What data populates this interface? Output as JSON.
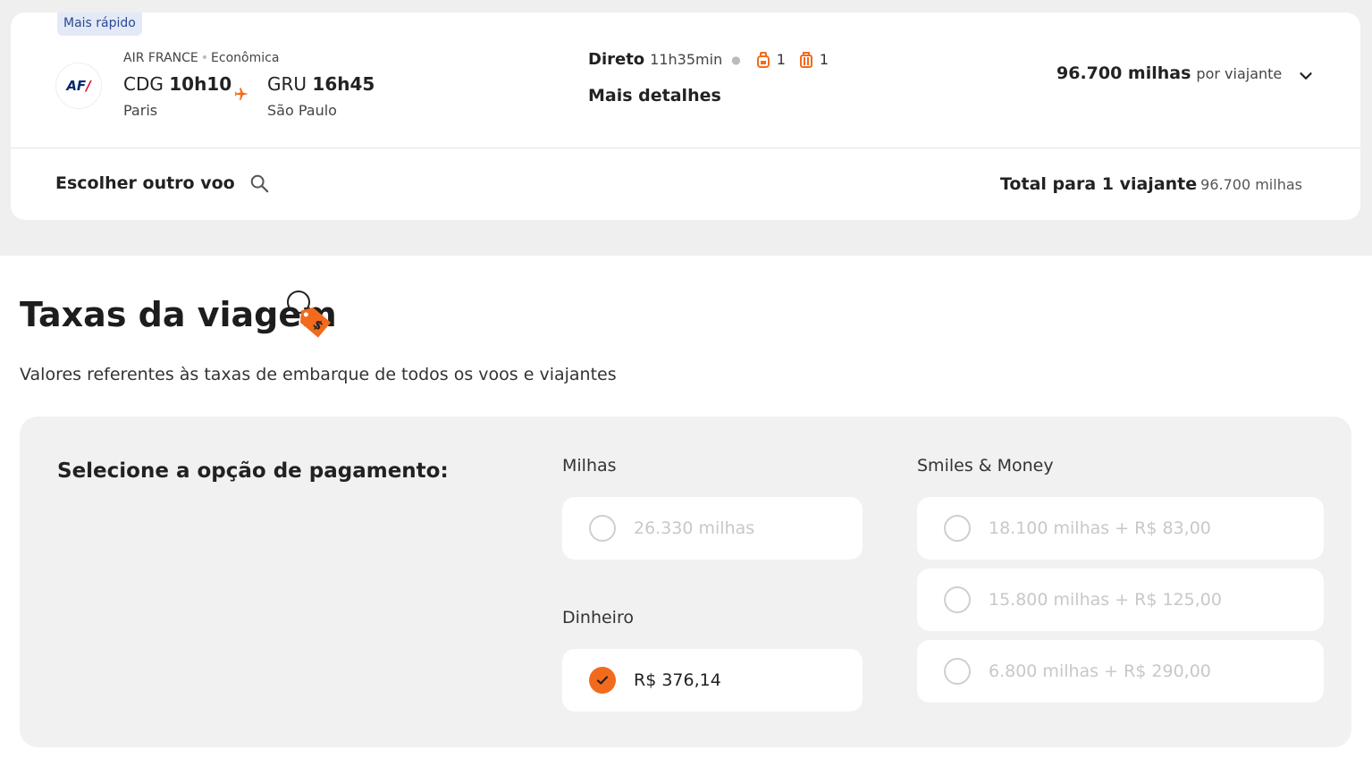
{
  "flight": {
    "badge": "Mais rápido",
    "airline_logo_text": "AF",
    "airline_logo_slash": "/",
    "airline": "AIR FRANCE",
    "cabin": "Econômica",
    "origin": {
      "code": "CDG",
      "time": "10h10",
      "city": "Paris"
    },
    "destination": {
      "code": "GRU",
      "time": "16h45",
      "city": "São Paulo"
    },
    "stops": "Direto",
    "duration": "11h35min",
    "carry_on_count": "1",
    "checked_bag_count": "1",
    "details_link": "Mais detalhes",
    "price": "96.700 milhas",
    "price_suffix": "por viajante",
    "choose_other": "Escolher outro voo",
    "total_label": "Total para 1 viajante",
    "total_value": "96.700 milhas"
  },
  "fees": {
    "title": "Taxas da viagem",
    "subtitle": "Valores referentes às taxas de embarque de todos os voos e viajantes",
    "payment_label": "Selecione a opção de pagamento:",
    "miles_group": "Milhas",
    "miles_option": "26.330 milhas",
    "cash_group": "Dinheiro",
    "cash_option": "R$ 376,14",
    "smiles_group": "Smiles & Money",
    "smiles_options": [
      "18.100 milhas + R$ 83,00",
      "15.800 milhas + R$ 125,00",
      "6.800 milhas + R$ 290,00"
    ]
  },
  "colors": {
    "accent": "#f26b1d",
    "badge_bg": "#e3e9f7",
    "panel_bg": "#f1f1f1"
  }
}
